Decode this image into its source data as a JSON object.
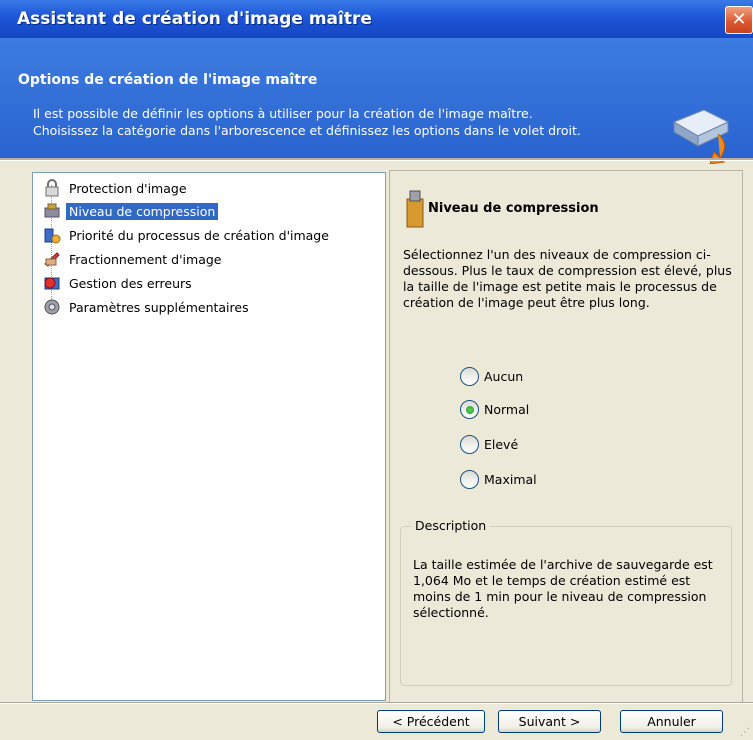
{
  "window": {
    "title": "Assistant de création d'image maître",
    "close_label": "✕"
  },
  "header": {
    "title": "Options de création de l'image maître",
    "line1": "Il est possible de définir les options à utiliser pour la création de l'image maître.",
    "line2": "Choisissez la catégorie dans l'arborescence et définissez les options dans le volet droit."
  },
  "tree": {
    "items": [
      {
        "label": "Protection d'image",
        "icon": "lock-icon"
      },
      {
        "label": "Niveau de compression",
        "icon": "compression-icon"
      },
      {
        "label": "Priorité du processus de création d'image",
        "icon": "priority-icon"
      },
      {
        "label": "Fractionnement d'image",
        "icon": "split-icon"
      },
      {
        "label": "Gestion des erreurs",
        "icon": "error-icon"
      },
      {
        "label": "Paramètres supplémentaires",
        "icon": "settings-icon"
      }
    ],
    "selected_index": 1
  },
  "panel": {
    "title": "Niveau de compression",
    "description": "Sélectionnez l'un des niveaux de compression ci-dessous. Plus le taux de compression est élevé, plus la taille de l'image est petite mais le processus de création de l'image peut être plus long.",
    "options": [
      {
        "label": "Aucun",
        "checked": false
      },
      {
        "label": "Normal",
        "checked": true
      },
      {
        "label": "Elevé",
        "checked": false
      },
      {
        "label": "Maximal",
        "checked": false
      }
    ],
    "group_label": "Description",
    "group_text": "La taille estimée de l'archive de sauvegarde est 1,064 Mo et le temps de création estimé est moins de 1 min pour le niveau de compression sélectionné."
  },
  "buttons": {
    "previous": "< Précédent",
    "next": "Suivant >",
    "cancel": "Annuler"
  },
  "colors": {
    "titlebar": "#1c55d6",
    "header": "#2a64cf",
    "selection": "#316ac5",
    "dialog_bg": "#ece9d8"
  }
}
